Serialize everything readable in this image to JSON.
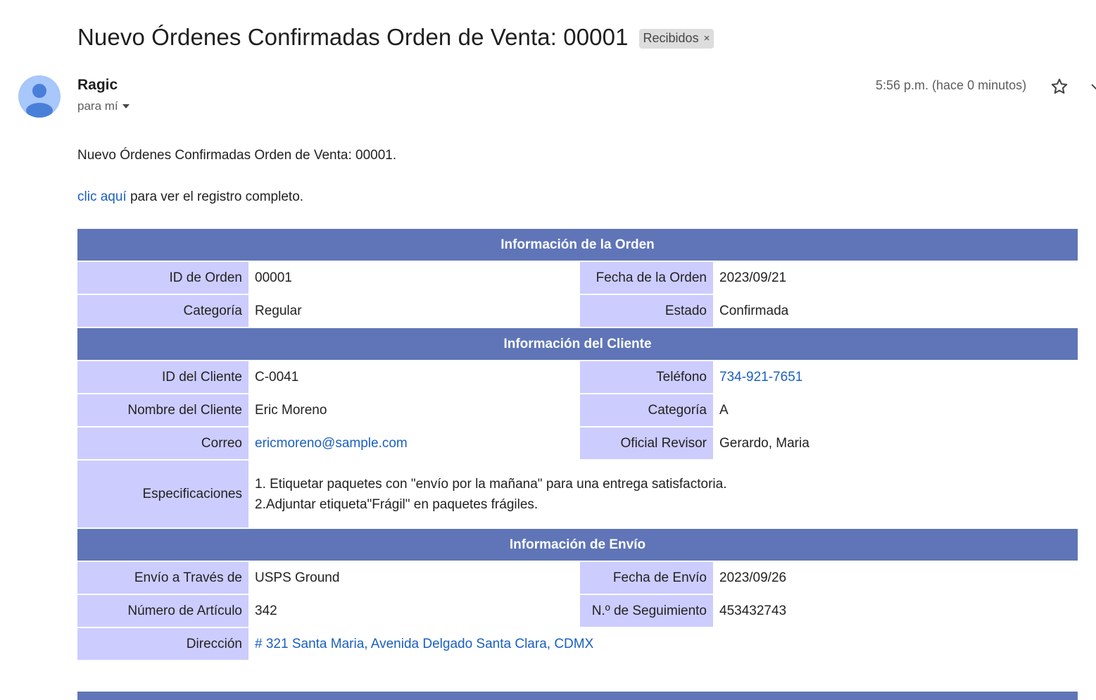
{
  "email": {
    "subject": "Nuevo Órdenes Confirmadas Orden de Venta: 00001",
    "label_chip": "Recibidos",
    "label_chip_close": "×",
    "sender_name": "Ragic",
    "recipient": "para mí",
    "timestamp": "5:56 p.m. (hace 0 minutos)"
  },
  "body": {
    "intro": "Nuevo Órdenes Confirmadas Orden de Venta: 00001.",
    "link_text": "clic aquí",
    "link_suffix": " para ver el registro completo."
  },
  "sections": {
    "order": {
      "title": "Información de la Orden",
      "order_id_label": "ID de Orden",
      "order_id": "00001",
      "order_date_label": "Fecha de la Orden",
      "order_date": "2023/09/21",
      "category_label": "Categoría",
      "category": "Regular",
      "status_label": "Estado",
      "status": "Confirmada"
    },
    "customer": {
      "title": "Información del Cliente",
      "customer_id_label": "ID del Cliente",
      "customer_id": "C-0041",
      "phone_label": "Teléfono",
      "phone": "734-921-7651",
      "name_label": "Nombre del Cliente",
      "name": "Eric Moreno",
      "category_label": "Categoría",
      "category": "A",
      "email_label": "Correo",
      "email": "ericmoreno@sample.com",
      "reviewer_label": "Oficial Revisor",
      "reviewer": "Gerardo, Maria",
      "specs_label": "Especificaciones",
      "specs_line1": "1. Etiquetar paquetes con \"envío por la mañana\" para una entrega satisfactoria.",
      "specs_line2": "2.Adjuntar etiqueta\"Frágil\" en paquetes frágiles."
    },
    "shipping": {
      "title": "Información de Envío",
      "via_label": "Envío a Través de",
      "via": "USPS Ground",
      "ship_date_label": "Fecha de Envío",
      "ship_date": "2023/09/26",
      "item_number_label": "Número de Artículo",
      "item_number": "342",
      "tracking_label": "N.º de Seguimiento",
      "tracking": "453432743",
      "address_label": "Dirección",
      "address": "# 321 Santa Maria, Avenida Delgado Santa Clara, CDMX"
    }
  },
  "colors": {
    "section_header": "#5f75b7",
    "label_cell": "#ccccff",
    "link": "#1a5fc0",
    "avatar": "#a8c7fa",
    "avatar_figure": "#4a7fd9"
  },
  "icons": {
    "avatar": "person-silhouette",
    "star": "star-outline",
    "caret": "caret-down"
  }
}
